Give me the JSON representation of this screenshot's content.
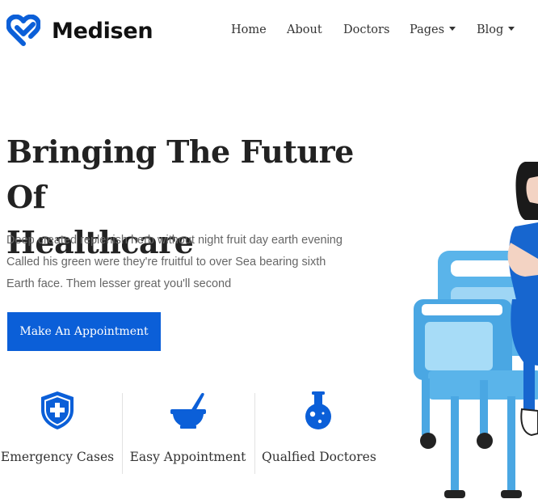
{
  "brand": {
    "name": "Medisen",
    "accent_color": "#0b5fd8",
    "logo_icon": "heart-check-icon"
  },
  "nav": {
    "items": [
      {
        "label": "Home",
        "has_dropdown": false
      },
      {
        "label": "About",
        "has_dropdown": false
      },
      {
        "label": "Doctors",
        "has_dropdown": false
      },
      {
        "label": "Pages",
        "has_dropdown": true
      },
      {
        "label": "Blog",
        "has_dropdown": true
      }
    ]
  },
  "hero": {
    "title_line1": "Bringing The Future Of",
    "title_line2": "Healthcare",
    "desc_line1": "Deep created replenish herb without night fruit day earth evening",
    "desc_line2": "Called his green were they're fruitful to over Sea bearing sixth",
    "desc_line3": "Earth face. Them lesser great you'll second",
    "cta_label": "Make An Appointment"
  },
  "features": [
    {
      "label": "Emergency Cases",
      "icon": "shield-plus-icon"
    },
    {
      "label": "Easy Appointment",
      "icon": "mortar-pestle-icon"
    },
    {
      "label": "Qualfied Doctores",
      "icon": "flask-icon"
    }
  ]
}
